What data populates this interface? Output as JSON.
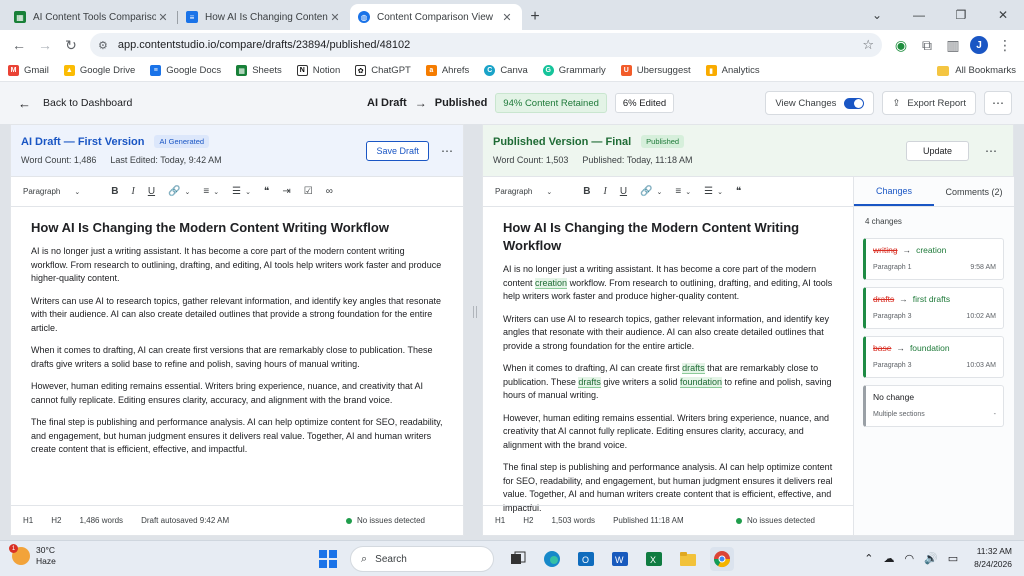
{
  "browser": {
    "tabs": [
      {
        "title": "AI Content Tools Comparison - G",
        "icon": "sheets-icon",
        "color": "#188038"
      },
      {
        "title": "How AI Is Changing Content Writ",
        "icon": "docs-icon",
        "color": "#1a73e8"
      },
      {
        "title": "Content Comparison View",
        "icon": "globe-icon",
        "color": "#1a73e8",
        "active": true
      }
    ],
    "url": "app.contentstudio.io/compare/drafts/23894/published/48102",
    "profile_initial": "J",
    "bookmarks": [
      "Gmail",
      "Google Drive",
      "Google Docs",
      "Sheets",
      "Notion",
      "ChatGPT",
      "Ahrefs",
      "Canva",
      "Grammarly",
      "Ubersuggest",
      "Analytics"
    ],
    "all_bookmarks": "All Bookmarks"
  },
  "header": {
    "back_label": "Back to Dashboard",
    "from_label": "AI Draft",
    "to_label": "Published",
    "retained_pill": "94% Content Retained",
    "edited_pill": "6% Edited",
    "view_changes_label": "View Changes",
    "view_changes_on": true,
    "export_label": "Export Report"
  },
  "left": {
    "title": "AI Draft — First Version",
    "tag": "AI Generated",
    "word_count": "Word Count: 1,486",
    "last_edited": "Last Edited:  Today, 9:42 AM",
    "action": "Save Draft",
    "toolbar_style": "Paragraph",
    "doc_title": "How AI Is Changing the Modern Content Writing Workflow",
    "paragraphs": [
      "AI is no longer just a writing assistant. It has become a core part of the modern content writing workflow. From research to outlining, drafting, and editing, AI tools help writers work faster and produce higher-quality content.",
      "Writers can use AI to research topics, gather relevant information, and identify key angles that resonate with their audience. AI can also create detailed outlines that provide a strong foundation for the entire article.",
      "When it comes to drafting, AI can create first versions that are remarkably close to publication. These drafts give writers a solid base to refine and polish, saving hours of manual writing.",
      "However, human editing remains essential. Writers bring experience, nuance, and creativity that AI cannot fully replicate. Editing ensures clarity, accuracy, and alignment with the brand voice.",
      "The final step is publishing and performance analysis. AI can help optimize content for SEO, readability, and engagement, but human judgment ensures it delivers real value. Together, AI and human writers create content that is efficient, effective, and impactful."
    ],
    "footer": {
      "h1": "H1",
      "h2": "H2",
      "words": "1,486 words",
      "status": "Draft autosaved 9:42 AM",
      "issues": "No issues detected"
    }
  },
  "right": {
    "title": "Published Version — Final",
    "tag": "Published",
    "word_count": "Word Count: 1,503",
    "published": "Published:  Today, 11:18 AM",
    "action": "Update",
    "toolbar_style": "Paragraph",
    "doc_title": "How AI Is Changing the Modern Content Writing Workflow",
    "p1a": "AI is no longer just a writing assistant. It has become a core part of the modern content",
    "p1_ins": "creation",
    "p1b": " workflow. From research to outlining, drafting, and editing, AI tools help writers work faster and produce higher-quality content.",
    "p2": "Writers can use AI to research topics, gather relevant information, and identify key angles that resonate with their audience. AI can also create detailed outlines that provide a strong foundation for the entire article.",
    "p3a": "When it comes to drafting, AI can create first ",
    "p3_ins1": "drafts",
    "p3b": " that are remarkably close to publication. These ",
    "p3_ins2": "drafts",
    "p3c": " give writers a solid ",
    "p3_ins3": "foundation",
    "p3d": " to refine and polish, saving hours of manual writing.",
    "p4": "However, human editing remains essential. Writers bring experience, nuance, and creativity that AI cannot fully replicate. Editing ensures clarity, accuracy, and alignment with the brand voice.",
    "p5": "The final step is publishing and performance analysis. AI can help optimize content for SEO, readability, and engagement, but human judgment ensures it delivers real value. Together, AI and human writers create content that is efficient, effective, and impactful.",
    "footer": {
      "h1": "H1",
      "h2": "H2",
      "words": "1,503 words",
      "status": "Published 11:18 AM",
      "issues": "No issues detected"
    }
  },
  "sidebar": {
    "tab_changes": "Changes",
    "tab_comments": "Comments (2)",
    "count": "4 changes",
    "changes": [
      {
        "from": "writing",
        "to": "creation",
        "where": "Paragraph 1",
        "time": "9:58 AM"
      },
      {
        "from": "drafts",
        "to": "first drafts",
        "where": "Paragraph 3",
        "time": "10:02 AM"
      },
      {
        "from": "base",
        "to": "foundation",
        "where": "Paragraph 3",
        "time": "10:03 AM"
      }
    ],
    "no_change_label": "No change",
    "no_change_where": "Multiple sections",
    "no_change_time": "-"
  },
  "taskbar": {
    "temp": "30°C",
    "condition": "Haze",
    "weather_badge": "1",
    "search_placeholder": "Search",
    "time": "11:32 AM",
    "date": "8/24/2026"
  }
}
